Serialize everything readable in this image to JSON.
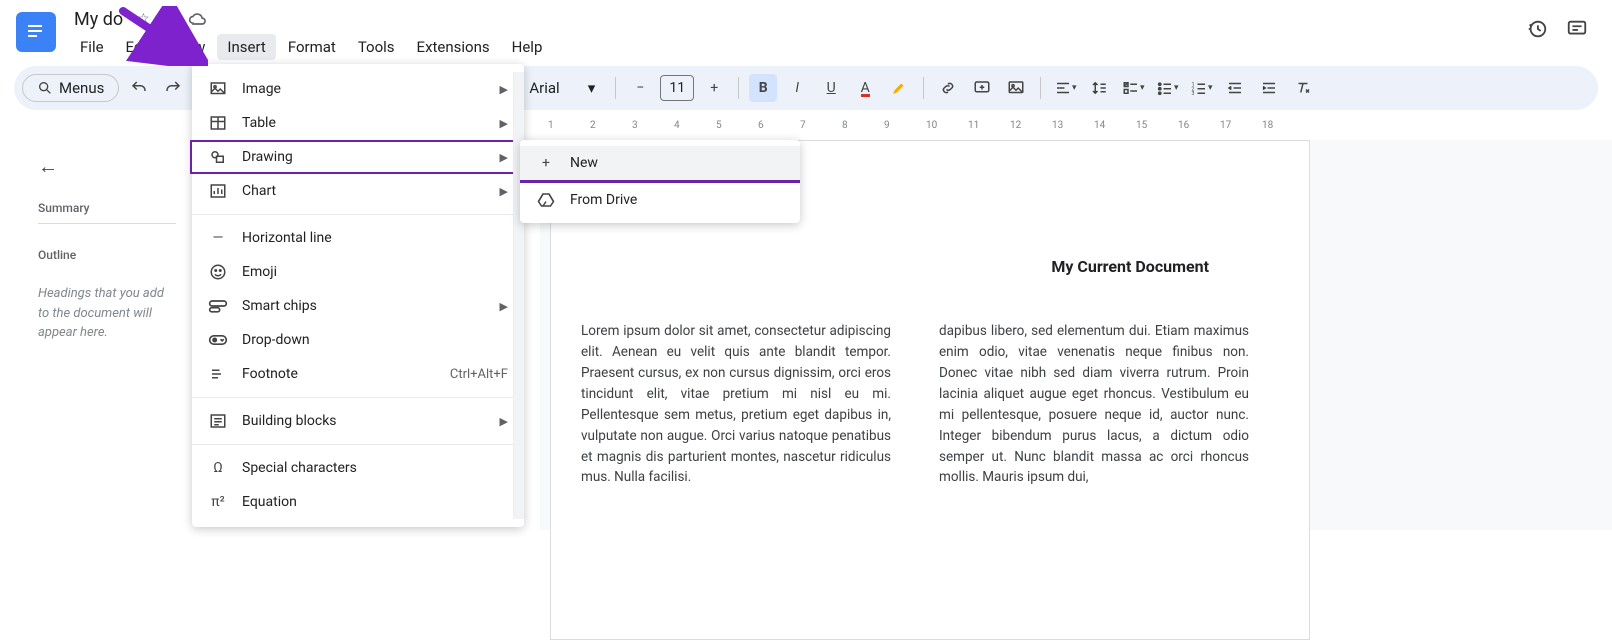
{
  "doc": {
    "title": "My do",
    "title_full_hint": "My document"
  },
  "menubar": [
    "File",
    "Edit",
    "View",
    "Insert",
    "Format",
    "Tools",
    "Extensions",
    "Help"
  ],
  "active_menu_index": 3,
  "toolbar": {
    "menus_label": "Menus",
    "font": "Arial",
    "font_size": "11"
  },
  "insert_menu": {
    "items": [
      {
        "label": "Image",
        "icon": "image-icon",
        "submenu": true
      },
      {
        "label": "Table",
        "icon": "table-icon",
        "submenu": true
      },
      {
        "label": "Drawing",
        "icon": "drawing-icon",
        "submenu": true,
        "highlight": true
      },
      {
        "label": "Chart",
        "icon": "chart-icon",
        "submenu": true
      }
    ],
    "items2": [
      {
        "label": "Horizontal line",
        "icon": "hline-icon"
      },
      {
        "label": "Emoji",
        "icon": "emoji-icon"
      },
      {
        "label": "Smart chips",
        "icon": "chip-icon",
        "submenu": true
      },
      {
        "label": "Drop-down",
        "icon": "dropdown-icon"
      },
      {
        "label": "Footnote",
        "icon": "footnote-icon",
        "shortcut": "Ctrl+Alt+F"
      }
    ],
    "items3": [
      {
        "label": "Building blocks",
        "icon": "blocks-icon",
        "submenu": true
      }
    ],
    "items4": [
      {
        "label": "Special characters",
        "icon": "omega-icon"
      },
      {
        "label": "Equation",
        "icon": "pi-icon"
      }
    ]
  },
  "drawing_submenu": [
    {
      "label": "New",
      "icon": "plus-icon",
      "hover": true
    },
    {
      "label": "From Drive",
      "icon": "drive-icon"
    }
  ],
  "outline": {
    "summary_label": "Summary",
    "outline_label": "Outline",
    "hint": "Headings that you add to the document will appear here."
  },
  "ruler_numbers": [
    "1",
    "2",
    "3",
    "4",
    "5",
    "6",
    "7",
    "8",
    "9",
    "10",
    "11",
    "12",
    "13",
    "14",
    "15",
    "16",
    "17",
    "18"
  ],
  "page": {
    "heading": "My Current Document",
    "col1": "Lorem ipsum dolor sit amet, consectetur adipiscing elit. Aenean eu velit quis ante blandit tempor. Praesent cursus, ex non cursus dignissim, orci eros tincidunt elit, vitae pretium mi nisl eu mi. Pellentesque sem metus, pretium eget dapibus in, vulputate non augue. Orci varius natoque penatibus et magnis dis parturient montes, nascetur ridiculus mus. Nulla facilisi.",
    "col2": "dapibus libero, sed elementum dui. Etiam maximus enim odio, vitae venenatis neque finibus non. Donec vitae nibh sed diam viverra rutrum. Proin lacinia aliquet augue eget rhoncus. Vestibulum eu mi pellentesque, posuere neque id, auctor nunc. Integer bibendum purus lacus, a dictum odio semper ut. Nunc blandit massa ac orci rhoncus mollis. Mauris ipsum dui,"
  }
}
